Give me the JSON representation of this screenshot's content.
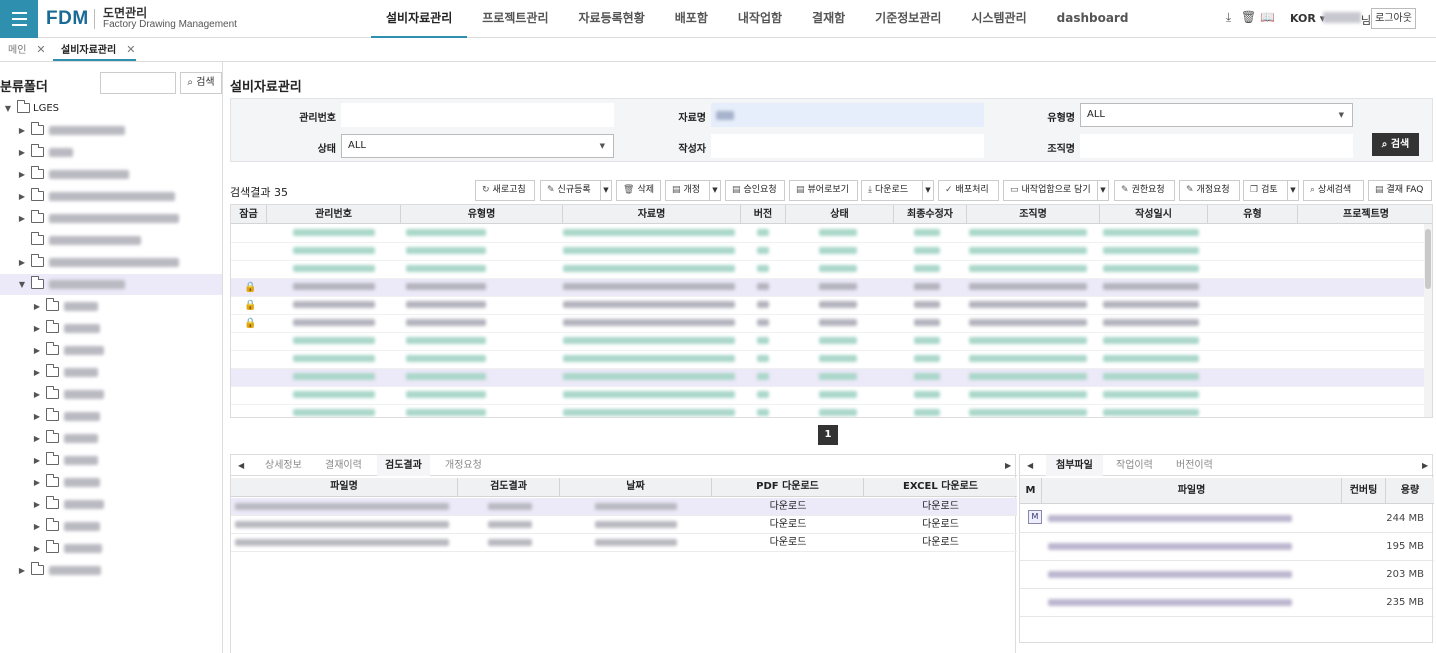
{
  "app": {
    "logo": "FDM",
    "subtitle_ko": "도면관리",
    "subtitle_en": "Factory Drawing Management"
  },
  "gnb": [
    "설비자료관리",
    "프로젝트관리",
    "자료등록현황",
    "배포함",
    "내작업함",
    "결재함",
    "기준정보관리",
    "시스템관리",
    "dashboard"
  ],
  "header": {
    "lang": "KOR",
    "user_suffix": "님",
    "logout": "로그아웃",
    "icons": [
      "download-icon",
      "trash-icon",
      "book-icon"
    ]
  },
  "tabs": [
    {
      "label": "메인",
      "close": "✕"
    },
    {
      "label": "설비자료관리",
      "close": "✕"
    }
  ],
  "left": {
    "title": "분류폴더",
    "search_btn": "검색",
    "root": "LGES"
  },
  "main": {
    "title": "설비자료관리",
    "form": {
      "mgmt_no": "관리번호",
      "doc_name": "자료명",
      "type_name": "유형명",
      "type_value": "ALL",
      "status": "상태",
      "status_value": "ALL",
      "author": "작성자",
      "org_name": "조직명",
      "search_btn": "검색"
    },
    "result_label": "검색결과",
    "result_count": "35",
    "toolbar": [
      "새로고침",
      "신규등록",
      "삭제",
      "개정",
      "승인요청",
      "뷰어로보기",
      "다운로드",
      "배포처리",
      "내작업함으로 담기",
      "권한요청",
      "개정요청",
      "검토",
      "상세검색",
      "결재 FAQ"
    ],
    "columns": [
      "잠금",
      "관리번호",
      "유형명",
      "자료명",
      "버전",
      "상태",
      "최종수정자",
      "조직명",
      "작성일시",
      "유형",
      "프로젝트명"
    ],
    "page": "1"
  },
  "bottom": {
    "tabs": [
      "상세정보",
      "결재이력",
      "검도결과",
      "개정요청"
    ],
    "columns": [
      "파일명",
      "검도결과",
      "날짜",
      "PDF 다운로드",
      "EXCEL 다운로드"
    ],
    "rows": [
      {
        "pdf": "다운로드",
        "excel": "다운로드"
      },
      {
        "pdf": "다운로드",
        "excel": "다운로드"
      },
      {
        "pdf": "다운로드",
        "excel": "다운로드"
      }
    ]
  },
  "attach": {
    "tabs": [
      "첨부파일",
      "작업이력",
      "버전이력"
    ],
    "columns": [
      "M",
      "파일명",
      "컨버팅",
      "용량"
    ],
    "badge": "M",
    "sizes": [
      "244 MB",
      "195 MB",
      "203 MB",
      "235 MB"
    ]
  }
}
